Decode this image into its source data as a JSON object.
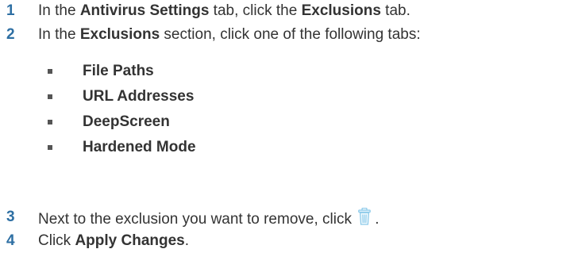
{
  "steps": [
    {
      "number": "1",
      "p1": "In the ",
      "b1": "Antivirus Settings",
      "p2": " tab, click the ",
      "b2": "Exclusions",
      "p3": " tab."
    },
    {
      "number": "2",
      "p1": "In the ",
      "b1": "Exclusions",
      "p2": " section, click one of the following tabs:"
    },
    {
      "number": "3",
      "p1": "Next to the exclusion you want to remove, click",
      "p2": " ."
    },
    {
      "number": "4",
      "p1": "Click ",
      "b1": "Apply Changes",
      "p2": "."
    }
  ],
  "tabs": [
    "File Paths",
    "URL Addresses",
    "DeepScreen",
    "Hardened Mode"
  ],
  "icons": {
    "remove": "trash-icon"
  },
  "colors": {
    "number": "#2e6fa3",
    "text": "#333333",
    "icon": "#8ecbea"
  }
}
